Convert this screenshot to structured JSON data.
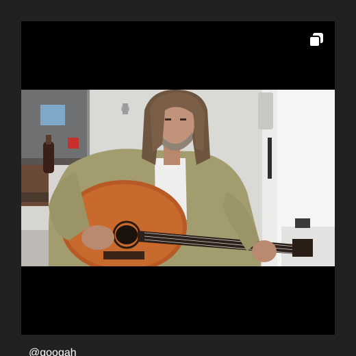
{
  "post": {
    "username": "@googah",
    "media_type_icon": "multiple-media-icon",
    "media": "video-frame"
  },
  "colors": {
    "page_background": "#212121",
    "frame_background": "#000000",
    "text": "#ffffff"
  }
}
